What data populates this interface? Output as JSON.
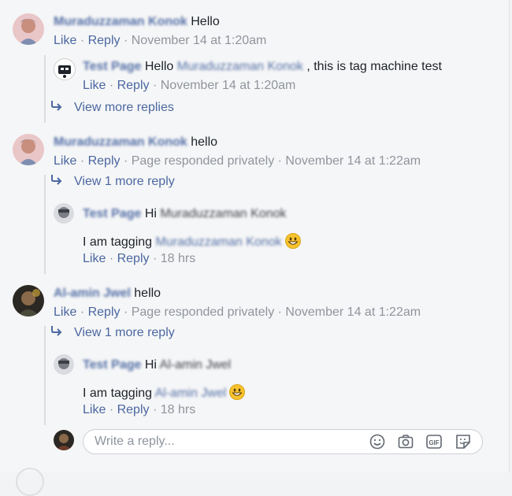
{
  "comments": [
    {
      "name": "Muraduzzaman Konok",
      "text": "Hello",
      "actions": {
        "like": "Like",
        "reply": "Reply",
        "sep": "·",
        "time": "November 14 at 1:20am"
      },
      "reply": {
        "name": "Test Page",
        "text_before": "Hello",
        "tag": "Muraduzzaman Konok",
        "text_after": ", this is tag machine test",
        "actions": {
          "like": "Like",
          "reply": "Reply",
          "sep": "·",
          "time": "November 14 at 1:20am"
        }
      },
      "more_replies": "View more replies"
    },
    {
      "name": "Muraduzzaman Konok",
      "text": "hello",
      "actions": {
        "like": "Like",
        "reply": "Reply",
        "sep": "·",
        "status": "Page responded privately",
        "time": "November 14 at 1:22am"
      },
      "more_replies": "View 1 more reply",
      "reply": {
        "name": "Test Page",
        "greeting": "Hi",
        "greeting_name": "Muraduzzaman Konok",
        "body": "I am tagging",
        "tag": "Muraduzzaman Konok",
        "emoji": "grinning-face-emoji",
        "actions": {
          "like": "Like",
          "reply": "Reply",
          "sep": "·",
          "time": "18 hrs"
        }
      }
    },
    {
      "name": "Al-amin Jwel",
      "text": "hello",
      "actions": {
        "like": "Like",
        "reply": "Reply",
        "sep": "·",
        "status": "Page responded privately",
        "time": "November 14 at 1:22am"
      },
      "more_replies": "View 1 more reply",
      "reply": {
        "name": "Test Page",
        "greeting": "Hi",
        "greeting_name": "Al-amin Jwel",
        "body": "I am tagging",
        "tag": "Al-amin Jwel",
        "emoji": "grinning-face-emoji",
        "actions": {
          "like": "Like",
          "reply": "Reply",
          "sep": "·",
          "time": "18 hrs"
        }
      }
    }
  ],
  "composer": {
    "placeholder": "Write a reply...",
    "tools": [
      "emoji-icon",
      "camera-icon",
      "gif-icon",
      "sticker-icon"
    ]
  },
  "colors": {
    "link": "#4b67a1",
    "name": "#385898",
    "meta": "#90949c",
    "background": "#f5f6f7"
  }
}
